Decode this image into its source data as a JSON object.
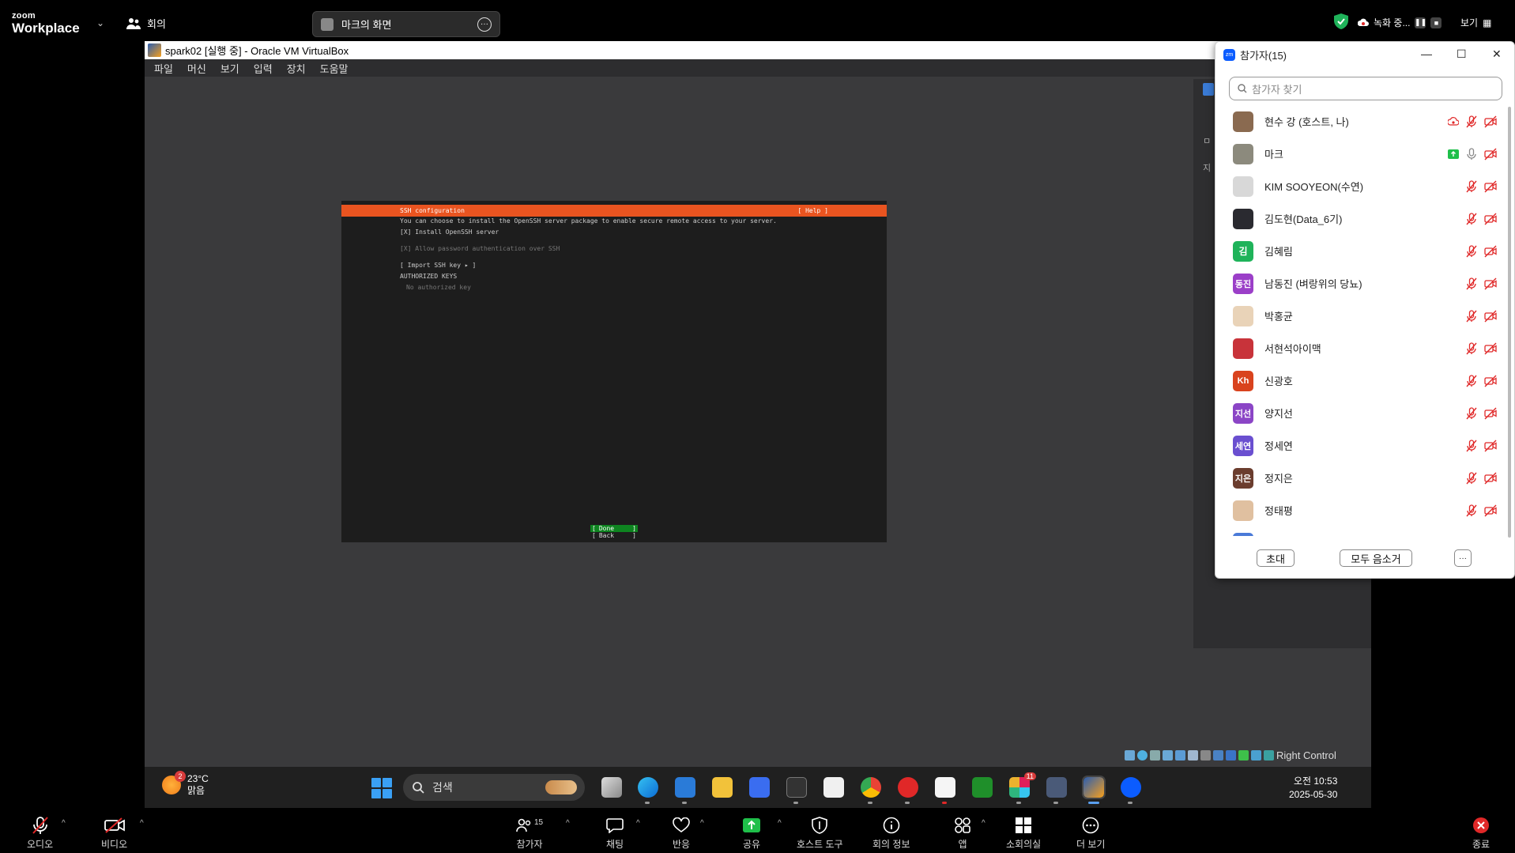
{
  "zoom_top": {
    "logo_small": "zoom",
    "logo_big": "Workplace",
    "meeting_label": "회의",
    "share_pill_label": "마크의 화면",
    "recording_label": "녹화 중...",
    "view_label": "보기"
  },
  "vbox": {
    "title": "spark02 [실행 중] - Oracle VM VirtualBox",
    "menu": [
      "파일",
      "머신",
      "보기",
      "입력",
      "장치",
      "도움말"
    ],
    "host_key": "Right Control",
    "side_letters": [
      "ㅁ",
      "지"
    ]
  },
  "installer": {
    "header": "SSH configuration",
    "help": "[ Help ]",
    "description": "You can choose to install the OpenSSH server package to enable secure remote access to your server.",
    "install_openssh": "[X]  Install OpenSSH server",
    "allow_password": "[X]  Allow password authentication over SSH",
    "import_key": "[ Import SSH key ▸ ]",
    "authorized_keys": "AUTHORIZED KEYS",
    "no_key": "No authorized key",
    "done": "Done",
    "back": "Back"
  },
  "taskbar": {
    "weather_temp": "23°C",
    "weather_desc": "맑음",
    "weather_badge": "2",
    "search_placeholder": "검색",
    "time": "오전 10:53",
    "date": "2025-05-30",
    "slack_badge": "11"
  },
  "participants_panel": {
    "title": "참가자(15)",
    "search_placeholder": "참가자 찾기",
    "invite": "초대",
    "mute_all": "모두 음소거",
    "more": "···",
    "participants": [
      {
        "name": "현수 강 (호스트, 나)",
        "avatar": "",
        "color": "#8a6a50"
      },
      {
        "name": "마크",
        "avatar": "",
        "color": "#8c8a7d"
      },
      {
        "name": "KIM SOOYEON(수연)",
        "avatar": "",
        "color": "#d8d8d8"
      },
      {
        "name": "김도현(Data_6기)",
        "avatar": "",
        "color": "#2a2a30"
      },
      {
        "name": "김혜림",
        "avatar": "김",
        "color": "#1fb35a"
      },
      {
        "name": "남동진 (벼랑위의 당뇨)",
        "avatar": "동진",
        "color": "#9b3fc8"
      },
      {
        "name": "박홍균",
        "avatar": "",
        "color": "#e9d3b8"
      },
      {
        "name": "서현석아이맥",
        "avatar": "",
        "color": "#c8333a"
      },
      {
        "name": "신광호",
        "avatar": "Kh",
        "color": "#d9431e"
      },
      {
        "name": "양지선",
        "avatar": "지선",
        "color": "#8b45c6"
      },
      {
        "name": "정세연",
        "avatar": "세연",
        "color": "#6a4fd0"
      },
      {
        "name": "정지은",
        "avatar": "지은",
        "color": "#6b3d2e"
      },
      {
        "name": "정태평",
        "avatar": "",
        "color": "#e0c0a0"
      },
      {
        "name": "",
        "avatar": "",
        "color": "#4a7ad8"
      }
    ]
  },
  "zoom_bottom": {
    "audio": "오디오",
    "video": "비디오",
    "participants": "참가자",
    "participants_count": "15",
    "chat": "채팅",
    "reactions": "반응",
    "share": "공유",
    "host_tools": "호스트 도구",
    "meeting_info": "회의 정보",
    "apps": "앱",
    "breakout": "소회의실",
    "more": "더 보기",
    "end": "종료"
  },
  "colors": {
    "ubuntu_orange": "#e95420",
    "done_green": "#0e8420",
    "share_green": "#1fbf4a",
    "end_red": "#e02828"
  }
}
